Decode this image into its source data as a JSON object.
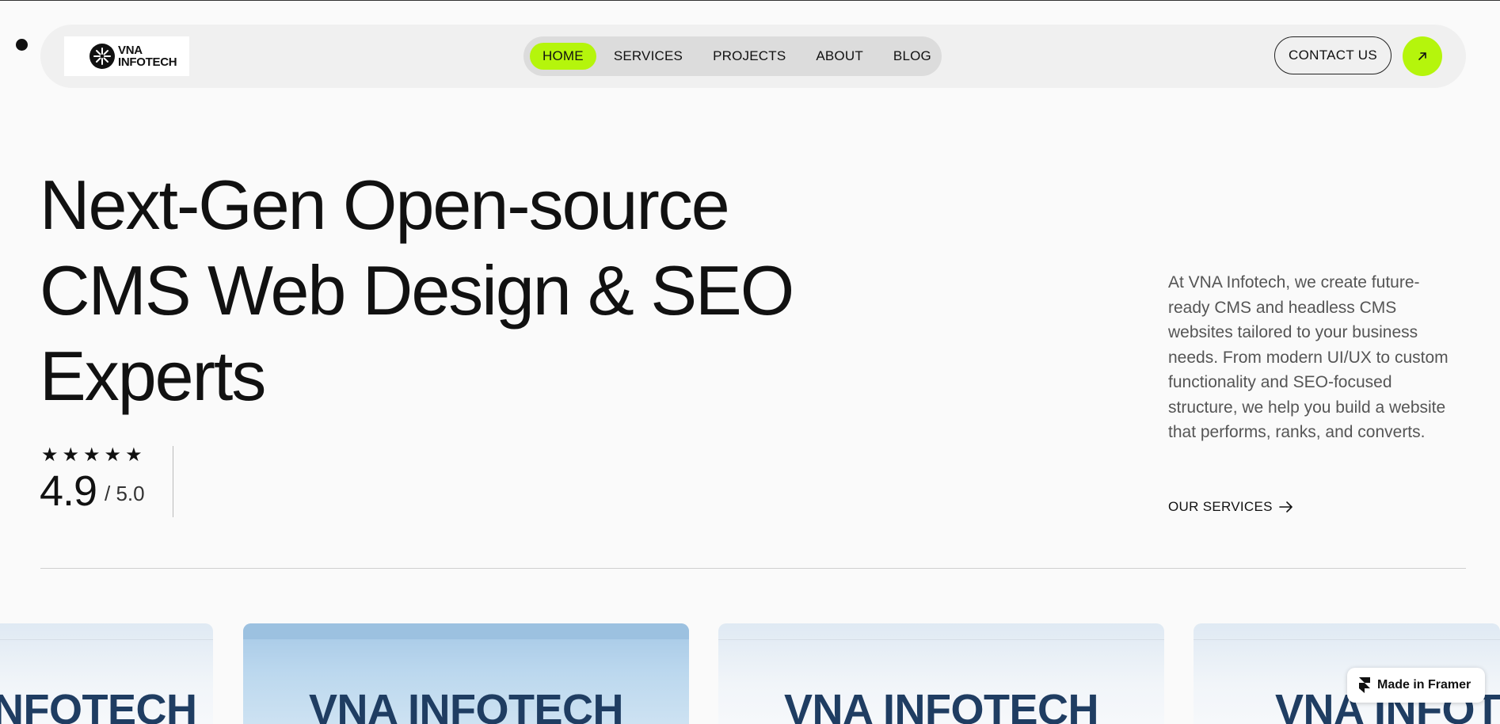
{
  "brand": {
    "logo_line1": "VNA",
    "logo_line2": "INFOTECH",
    "accent_color": "#b5f50c"
  },
  "nav": {
    "items": [
      {
        "label": "HOME",
        "active": true
      },
      {
        "label": "SERVICES",
        "active": false
      },
      {
        "label": "PROJECTS",
        "active": false
      },
      {
        "label": "ABOUT",
        "active": false
      },
      {
        "label": "BLOG",
        "active": false
      }
    ]
  },
  "header": {
    "contact_label": "CONTACT US",
    "arrow_icon": "arrow-up-right-icon"
  },
  "hero": {
    "title_line1": "Next-Gen Open-source",
    "title_line2": "CMS Web Design & SEO",
    "title_line3": "Experts",
    "rating_value": "4.9",
    "rating_max": "/ 5.0",
    "rating_stars": 5,
    "intro": "At VNA Infotech, we create future-ready CMS and headless CMS websites tailored to your business needs. From modern UI/UX to custom functionality and SEO-focused structure, we help you build a website that performs, ranks, and converts.",
    "services_link": "OUR SERVICES"
  },
  "cards": [
    {
      "text": "VNA INFOTECH"
    },
    {
      "text": "VNA INFOTECH"
    },
    {
      "text": "VNA INFOTECH"
    },
    {
      "text": "VNA INFOTECH"
    }
  ],
  "badge": {
    "label": "Made in Framer",
    "icon": "framer-icon"
  }
}
